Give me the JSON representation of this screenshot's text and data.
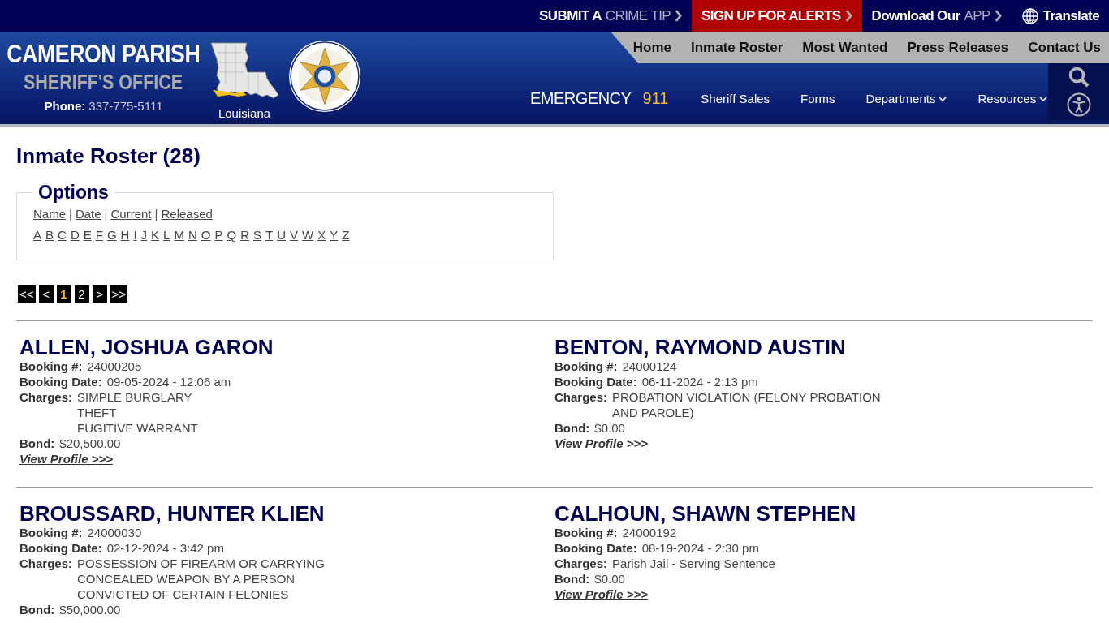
{
  "top_bar": {
    "links": [
      {
        "kind": "plain",
        "lead": "SUBMIT A",
        "accent": "CRIME TIP"
      },
      {
        "kind": "alert",
        "lead": "SIGN UP FOR ALERTS"
      },
      {
        "kind": "plain",
        "lead": "Download Our",
        "accent": "APP"
      }
    ],
    "translate": "Translate"
  },
  "header": {
    "title": "CAMERON PARISH",
    "subtitle": "SHERIFF'S OFFICE",
    "phone_label": "Phone:",
    "phone": "337-775-5111",
    "state": "Louisiana"
  },
  "main_nav": [
    "Home",
    "Inmate Roster",
    "Most Wanted",
    "Press Releases",
    "Contact Us"
  ],
  "emergency": {
    "label": "EMERGENCY",
    "number": "911"
  },
  "secondary_nav": [
    {
      "label": "Sheriff Sales",
      "dropdown": false
    },
    {
      "label": "Forms",
      "dropdown": false
    },
    {
      "label": "Departments",
      "dropdown": true
    },
    {
      "label": "Resources",
      "dropdown": true
    }
  ],
  "page_title": "Inmate Roster (28)",
  "options": {
    "legend": "Options",
    "sort_links": [
      "Name",
      "Date",
      "Current",
      "Released"
    ],
    "separators": [
      "|",
      "|",
      "|"
    ],
    "letters": [
      "A",
      "B",
      "C",
      "D",
      "E",
      "F",
      "G",
      "H",
      "I",
      "J",
      "K",
      "L",
      "M",
      "N",
      "O",
      "P",
      "Q",
      "R",
      "S",
      "T",
      "U",
      "V",
      "W",
      "X",
      "Y",
      "Z"
    ]
  },
  "pagination": [
    {
      "label": "<<",
      "selected": false
    },
    {
      "label": "<",
      "selected": false
    },
    {
      "label": "1",
      "selected": true
    },
    {
      "label": "2",
      "selected": false
    },
    {
      "label": ">",
      "selected": false
    },
    {
      "label": ">>",
      "selected": false
    }
  ],
  "inmates": [
    {
      "name": "ALLEN, JOSHUA GARON",
      "booking_label": "Booking #:",
      "booking": "24000205",
      "date_label": "Booking Date:",
      "date": "09-05-2024 - 12:06 am",
      "charges_label": "Charges:",
      "charges": [
        "SIMPLE BURGLARY",
        "THEFT",
        "FUGITIVE WARRANT"
      ],
      "bond_label": "Bond:",
      "bond": "$20,500.00",
      "link": "View Profile >>>"
    },
    {
      "name": "BENTON, RAYMOND AUSTIN",
      "booking_label": "Booking #:",
      "booking": "24000124",
      "date_label": "Booking Date:",
      "date": "06-11-2024 - 2:13 pm",
      "charges_label": "Charges:",
      "charges": [
        "PROBATION VIOLATION (FELONY PROBATION AND PAROLE)"
      ],
      "bond_label": "Bond:",
      "bond": "$0.00",
      "link": "View Profile >>>"
    },
    {
      "name": "BROUSSARD, HUNTER KLIEN",
      "booking_label": "Booking #:",
      "booking": "24000030",
      "date_label": "Booking Date:",
      "date": "02-12-2024 - 3:42 pm",
      "charges_label": "Charges:",
      "charges": [
        "POSSESSION OF FIREARM OR CARRYING CONCEALED WEAPON BY A PERSON CONVICTED OF CERTAIN FELONIES"
      ],
      "bond_label": "Bond:",
      "bond": "$50,000.00"
    },
    {
      "name": "CALHOUN, SHAWN STEPHEN",
      "booking_label": "Booking #:",
      "booking": "24000192",
      "date_label": "Booking Date:",
      "date": "08-19-2024 - 2:30 pm",
      "charges_label": "Charges:",
      "charges": [
        "Parish Jail - Serving Sentence"
      ],
      "bond_label": "Bond:",
      "bond": "$0.00",
      "link": "View Profile >>>"
    }
  ]
}
